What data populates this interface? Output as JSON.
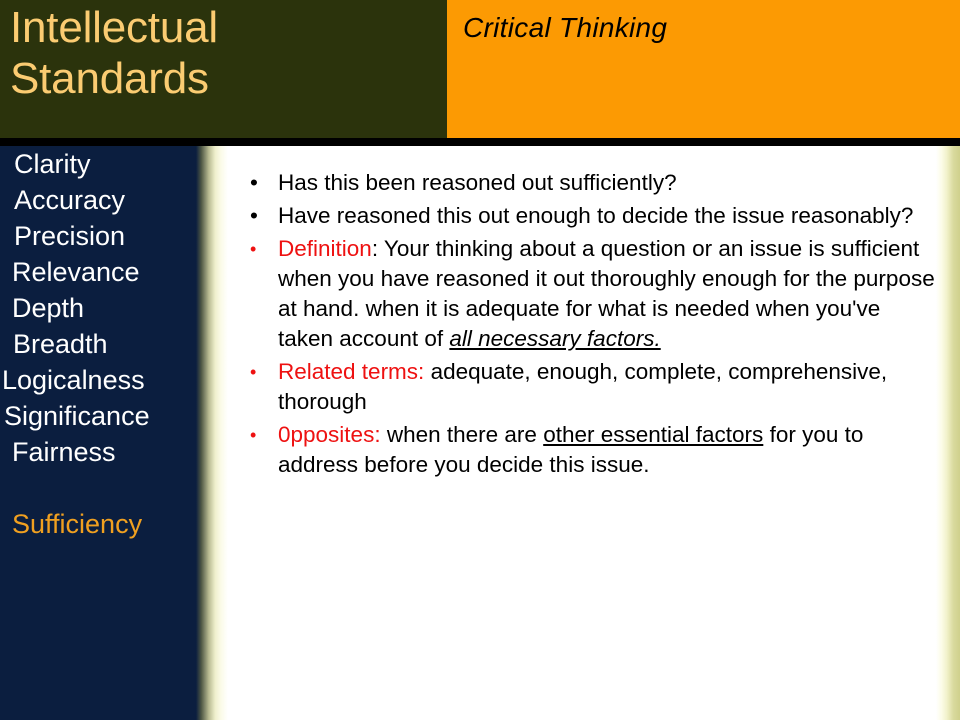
{
  "slide": {
    "title": "Intellectual\nStandards",
    "subtitle": "Critical Thinking",
    "colors": {
      "header_left_bg": "#2b330c",
      "header_right_bg": "#fc9a03",
      "title_text": "#fbcc72",
      "sidebar_bg": "#0b1e3f",
      "sidebar_text": "#ffffff",
      "sidebar_active_text": "#f0a020",
      "accent_red": "#ee1111",
      "content_bg": "#ffffff",
      "rule": "#000000"
    }
  },
  "sidebar": {
    "items": [
      {
        "label": "Clarity",
        "active": false,
        "indent": 14
      },
      {
        "label": "Accuracy",
        "active": false,
        "indent": 14
      },
      {
        "label": "Precision",
        "active": false,
        "indent": 14
      },
      {
        "label": "Relevance",
        "active": false,
        "indent": 12
      },
      {
        "label": "Depth",
        "active": false,
        "indent": 12
      },
      {
        "label": "Breadth",
        "active": false,
        "indent": 13
      },
      {
        "label": "Logicalness",
        "active": false,
        "indent": 2
      },
      {
        "label": "Significance",
        "active": false,
        "indent": 4
      },
      {
        "label": "Fairness",
        "active": false,
        "indent": 12
      },
      {
        "label": "",
        "active": false,
        "indent": 0
      },
      {
        "label": "Sufficiency",
        "active": true,
        "indent": 12
      }
    ]
  },
  "content": {
    "bullets": [
      {
        "marker_color": "black",
        "runs": [
          {
            "text": "Has this been reasoned out sufficiently?",
            "style": "plain"
          }
        ]
      },
      {
        "marker_color": "black",
        "runs": [
          {
            "text": "Have reasoned this out enough to decide the issue reasonably?",
            "style": "plain"
          }
        ]
      },
      {
        "marker_color": "red",
        "runs": [
          {
            "text": "Definition",
            "style": "label-red"
          },
          {
            "text": ": Your thinking about a question or an issue is sufficient when you have reasoned it out thoroughly enough for the purpose at hand. when it is adequate for what is needed when you've taken account of ",
            "style": "plain"
          },
          {
            "text": "all necessary factors.",
            "style": "italic-underline"
          }
        ]
      },
      {
        "marker_color": "red",
        "runs": [
          {
            "text": "Related terms:",
            "style": "label-red"
          },
          {
            "text": " adequate, enough, complete, comprehensive, thorough",
            "style": "plain"
          }
        ]
      },
      {
        "marker_color": "red",
        "runs": [
          {
            "text": "0pposites:",
            "style": "label-red"
          },
          {
            "text": " when there are ",
            "style": "plain"
          },
          {
            "text": "other essential factors",
            "style": "underline"
          },
          {
            "text": " for you to address before you decide this issue.",
            "style": "plain"
          }
        ]
      }
    ]
  }
}
